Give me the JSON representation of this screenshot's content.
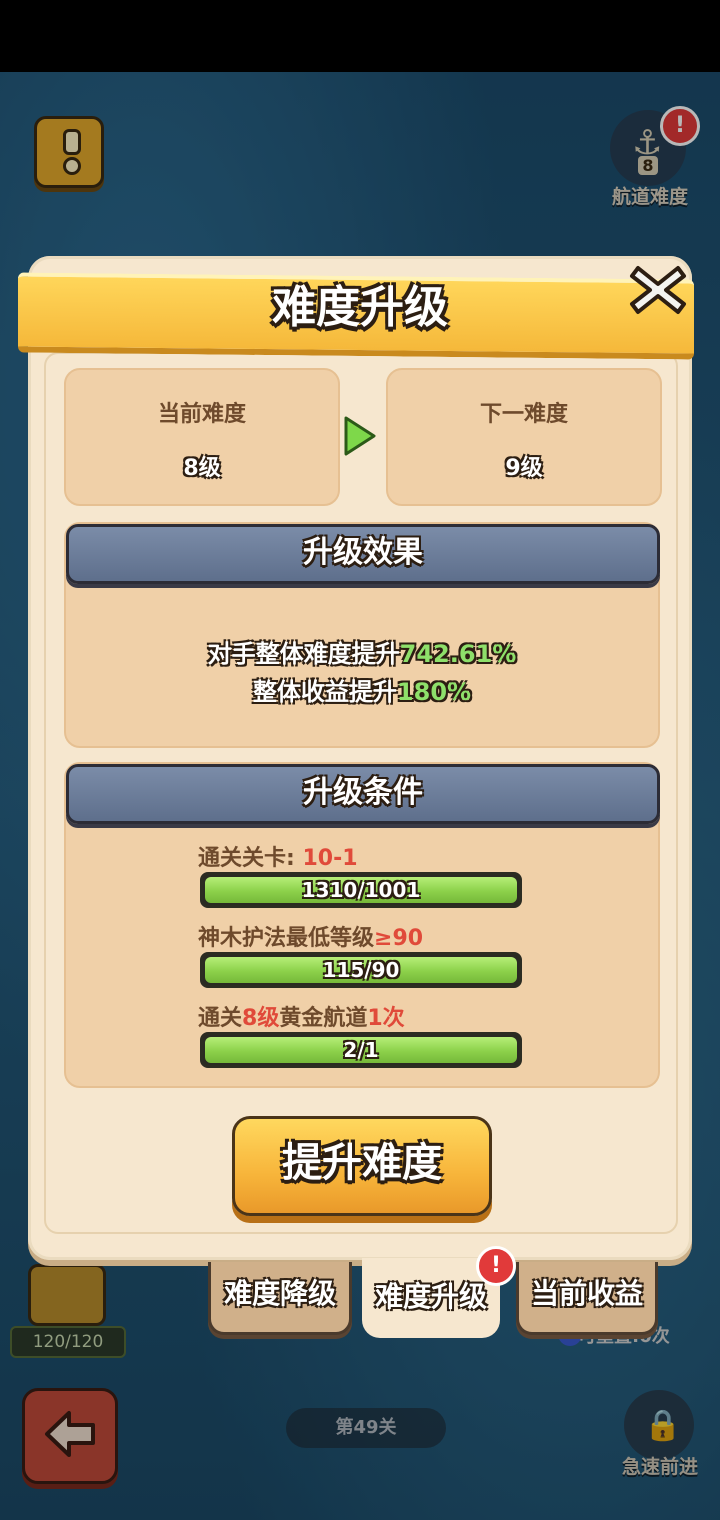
{
  "background": {
    "lane_label": "航道难度",
    "lane_level": "8",
    "chest_counter": "120/120",
    "level_indicator": "第49关",
    "rush_label": "急速前进",
    "reset_text": "可重置:0次",
    "alert_badge": "!"
  },
  "modal": {
    "title": "难度升级",
    "current_label": "当前难度",
    "current_value": "8级",
    "next_label": "下一难度",
    "next_value": "9级",
    "effects": {
      "header": "升级效果",
      "line1_prefix": "对手整体难度提升",
      "line1_value": "742.61%",
      "line2_prefix": "整体收益提升",
      "line2_value": "180%"
    },
    "conditions": {
      "header": "升级条件",
      "items": [
        {
          "label": "通关关卡:",
          "value": "10-1",
          "progress_text": "1310/1001",
          "progress": 1.0
        },
        {
          "label": "神木护法最低等级",
          "value": "≥90",
          "progress_text": "115/90",
          "progress": 1.0
        },
        {
          "label_a": "通关",
          "label_b": "8级",
          "label_c": "黄金航道",
          "label_d": "1次",
          "progress_text": "2/1",
          "progress": 1.0
        }
      ]
    },
    "action_button": "提升难度"
  },
  "tabs": [
    {
      "label": "难度降级",
      "active": false
    },
    {
      "label": "难度升级",
      "active": true,
      "badge": "!"
    },
    {
      "label": "当前收益",
      "active": false
    }
  ],
  "colors": {
    "accent_green": "#8ee06a",
    "accent_red": "#e04a3a",
    "banner_gold": "#f5b83a",
    "panel_bg": "#f6e7cf"
  }
}
